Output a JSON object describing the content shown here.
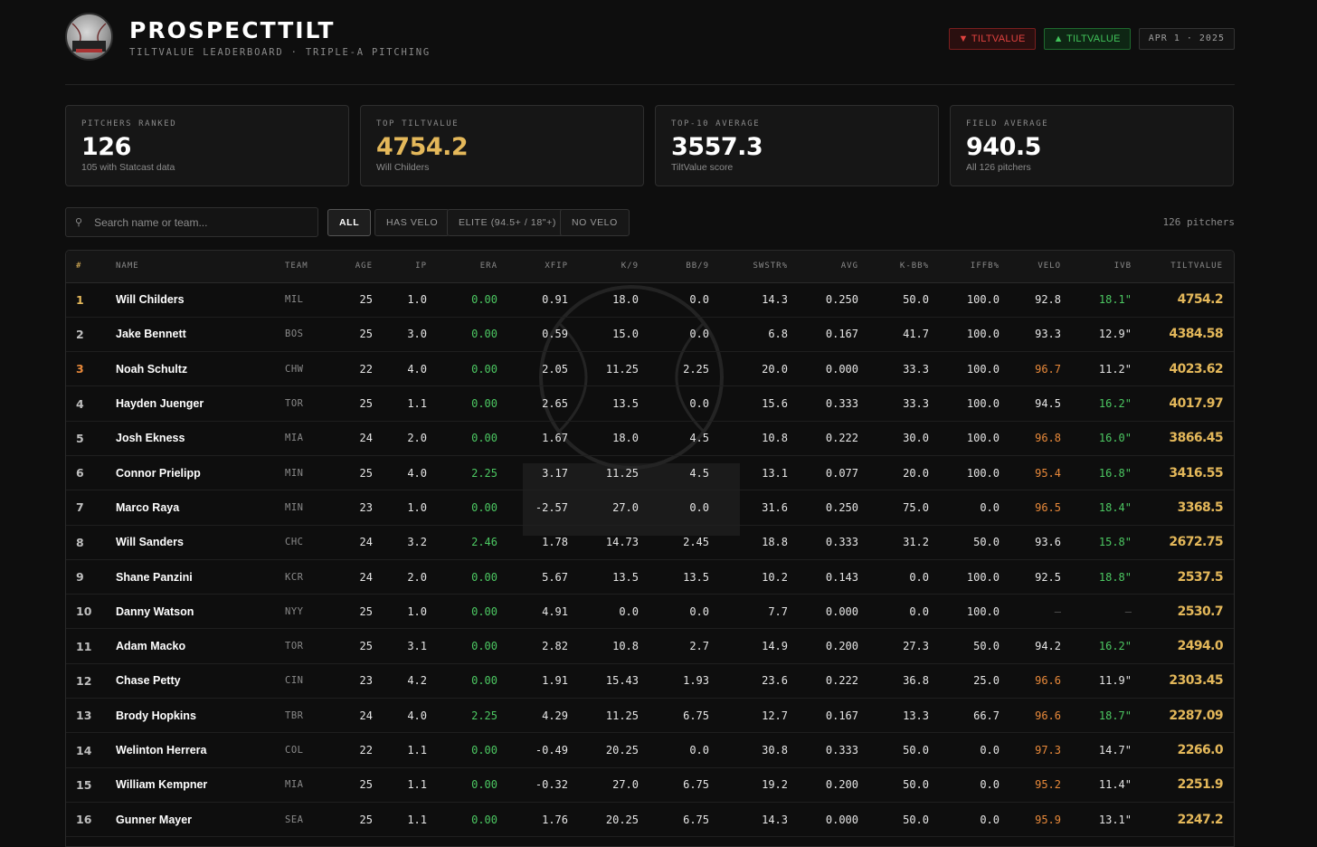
{
  "brand": {
    "name": "PROSPECTTILT",
    "subtitle": "TILTVALUE LEADERBOARD  ·  TRIPLE-A PITCHING",
    "badge_down": "▼ TILTVALUE",
    "badge_up": "▲ TILTVALUE",
    "date": "APR 1 · 2025"
  },
  "stats": [
    {
      "label": "PITCHERS RANKED",
      "value": "126",
      "sub": "105 with Statcast data"
    },
    {
      "label": "TOP TILTVALUE",
      "value": "4754.2",
      "sub": "Will Childers"
    },
    {
      "label": "TOP-10 AVERAGE",
      "value": "3557.3",
      "sub": "TiltValue score"
    },
    {
      "label": "FIELD AVERAGE",
      "value": "940.5",
      "sub": "All 126 pitchers"
    }
  ],
  "search": {
    "placeholder": "Search name or team..."
  },
  "filters": [
    "ALL",
    "HAS VELO",
    "ELITE (94.5+ / 18\"+)",
    "NO VELO"
  ],
  "count": "126 pitchers",
  "columns": [
    "#",
    "NAME",
    "TEAM",
    "AGE",
    "IP",
    "ERA",
    "XFIP",
    "K/9",
    "BB/9",
    "SWSTR%",
    "AVG",
    "K-BB%",
    "IFFB%",
    "VELO",
    "IVB",
    "TILTVALUE"
  ],
  "rows": [
    [
      "1",
      "Will Childers",
      "MIL",
      "25",
      "1.0",
      "0.00",
      "0.91",
      "18.0",
      "0.0",
      "14.3",
      "0.250",
      "50.0",
      "100.0",
      "92.8",
      "18.1\"",
      "4754.2"
    ],
    [
      "2",
      "Jake Bennett",
      "BOS",
      "25",
      "3.0",
      "0.00",
      "0.59",
      "15.0",
      "0.0",
      "6.8",
      "0.167",
      "41.7",
      "100.0",
      "93.3",
      "12.9\"",
      "4384.58"
    ],
    [
      "3",
      "Noah Schultz",
      "CHW",
      "22",
      "4.0",
      "0.00",
      "2.05",
      "11.25",
      "2.25",
      "20.0",
      "0.000",
      "33.3",
      "100.0",
      "96.7",
      "11.2\"",
      "4023.62"
    ],
    [
      "4",
      "Hayden Juenger",
      "TOR",
      "25",
      "1.1",
      "0.00",
      "2.65",
      "13.5",
      "0.0",
      "15.6",
      "0.333",
      "33.3",
      "100.0",
      "94.5",
      "16.2\"",
      "4017.97"
    ],
    [
      "5",
      "Josh Ekness",
      "MIA",
      "24",
      "2.0",
      "0.00",
      "1.67",
      "18.0",
      "4.5",
      "10.8",
      "0.222",
      "30.0",
      "100.0",
      "96.8",
      "16.0\"",
      "3866.45"
    ],
    [
      "6",
      "Connor Prielipp",
      "MIN",
      "25",
      "4.0",
      "2.25",
      "3.17",
      "11.25",
      "4.5",
      "13.1",
      "0.077",
      "20.0",
      "100.0",
      "95.4",
      "16.8\"",
      "3416.55"
    ],
    [
      "7",
      "Marco Raya",
      "MIN",
      "23",
      "1.0",
      "0.00",
      "-2.57",
      "27.0",
      "0.0",
      "31.6",
      "0.250",
      "75.0",
      "0.0",
      "96.5",
      "18.4\"",
      "3368.5"
    ],
    [
      "8",
      "Will Sanders",
      "CHC",
      "24",
      "3.2",
      "2.46",
      "1.78",
      "14.73",
      "2.45",
      "18.8",
      "0.333",
      "31.2",
      "50.0",
      "93.6",
      "15.8\"",
      "2672.75"
    ],
    [
      "9",
      "Shane Panzini",
      "KCR",
      "24",
      "2.0",
      "0.00",
      "5.67",
      "13.5",
      "13.5",
      "10.2",
      "0.143",
      "0.0",
      "100.0",
      "92.5",
      "18.8\"",
      "2537.5"
    ],
    [
      "10",
      "Danny Watson",
      "NYY",
      "25",
      "1.0",
      "0.00",
      "4.91",
      "0.0",
      "0.0",
      "7.7",
      "0.000",
      "0.0",
      "100.0",
      "—",
      "—",
      "2530.7"
    ],
    [
      "11",
      "Adam Macko",
      "TOR",
      "25",
      "3.1",
      "0.00",
      "2.82",
      "10.8",
      "2.7",
      "14.9",
      "0.200",
      "27.3",
      "50.0",
      "94.2",
      "16.2\"",
      "2494.0"
    ],
    [
      "12",
      "Chase Petty",
      "CIN",
      "23",
      "4.2",
      "0.00",
      "1.91",
      "15.43",
      "1.93",
      "23.6",
      "0.222",
      "36.8",
      "25.0",
      "96.6",
      "11.9\"",
      "2303.45"
    ],
    [
      "13",
      "Brody Hopkins",
      "TBR",
      "24",
      "4.0",
      "2.25",
      "4.29",
      "11.25",
      "6.75",
      "12.7",
      "0.167",
      "13.3",
      "66.7",
      "96.6",
      "18.7\"",
      "2287.09"
    ],
    [
      "14",
      "Welinton Herrera",
      "COL",
      "22",
      "1.1",
      "0.00",
      "-0.49",
      "20.25",
      "0.0",
      "30.8",
      "0.333",
      "50.0",
      "0.0",
      "97.3",
      "14.7\"",
      "2266.0"
    ],
    [
      "15",
      "William Kempner",
      "MIA",
      "25",
      "1.1",
      "0.00",
      "-0.32",
      "27.0",
      "6.75",
      "19.2",
      "0.200",
      "50.0",
      "0.0",
      "95.2",
      "11.4\"",
      "2251.9"
    ],
    [
      "16",
      "Gunner Mayer",
      "SEA",
      "25",
      "1.1",
      "0.00",
      "1.76",
      "20.25",
      "6.75",
      "14.3",
      "0.000",
      "50.0",
      "0.0",
      "95.9",
      "13.1\"",
      "2247.2"
    ]
  ],
  "colors": {
    "gold": "#e4b85a",
    "green": "#4cc862",
    "orange": "#e8893a",
    "red": "#e0423f"
  }
}
